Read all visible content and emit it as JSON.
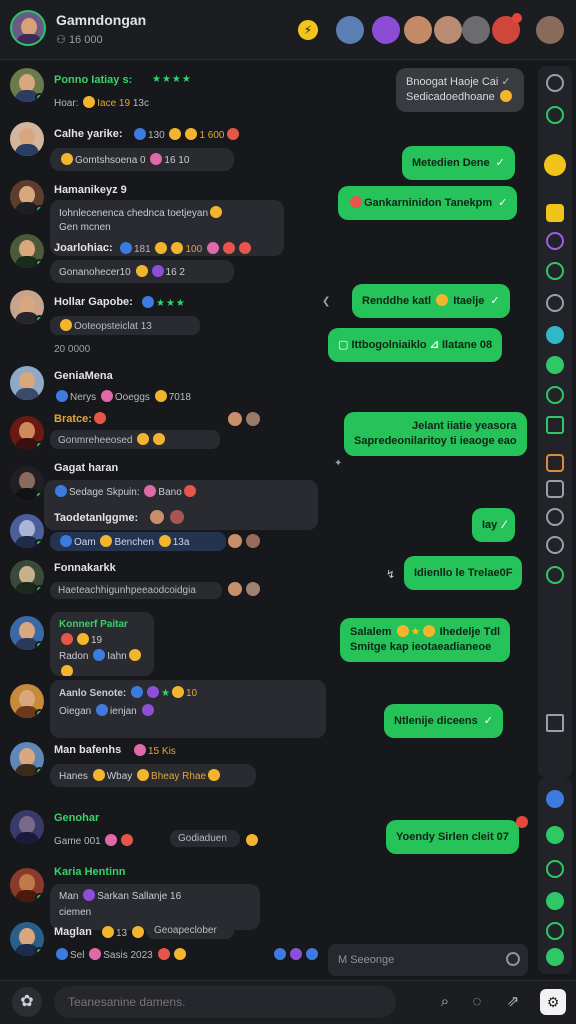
{
  "header": {
    "title": "Gamndongan",
    "subtitle": "16 000",
    "members_count_icon": "people-icon",
    "bolt_icon": "lightning-icon",
    "member_colors": [
      "#5b7fb5",
      "#8b4dd6",
      "#c28a66",
      "#b98b72",
      "#6b6b70",
      "#d1463a",
      "#8a6a5a"
    ]
  },
  "incoming": [
    {
      "name": "Ponno Iatiay s:",
      "meta": "Hoar: ",
      "meta_gold": "Iace 19",
      "meta2": "13c",
      "stars": "★★★★",
      "color": "#6a7a4a"
    },
    {
      "name": "Calhe yarike:",
      "meta": "130",
      "meta_gold": "1 600",
      "bubble": "Gomtshsoena 0",
      "bubble_tail": "16 10",
      "color": "#d3b6a0"
    },
    {
      "name": "Hamanikeyz 9",
      "bubble": "Iohnlecenenca chednca toetjeyan",
      "bubble2": "Gen mcnen",
      "color": "#5e3d2d"
    },
    {
      "name": "Joarlohiac:",
      "meta": "181",
      "meta_gold": "100",
      "bubble": "Gonanohecer10",
      "bubble_tail": "16 2",
      "color": "#4a5a3a"
    },
    {
      "name": "Hollar Gapobe:",
      "stars": "★★★",
      "bubble": "Ooteopsteiclat 13",
      "dateline": "20 0000",
      "color": "#c7a48a"
    },
    {
      "name": "GeniaMena",
      "meta": "Nerys",
      "meta2": "Ooeggs",
      "meta3": "7018",
      "color": "#8fa9c7"
    },
    {
      "name": "Bratce:",
      "bubble": "Gonmreheeosed",
      "color": "#6a1a10"
    },
    {
      "name": "Gagat haran",
      "bubble": "Sedage Skpuin:",
      "bubble_tail": "Bano",
      "color": "#202024"
    },
    {
      "name": "Taodetanlggme:",
      "bubble": "Oam",
      "bubble_mid": "Benchen",
      "bubble_tail": "13a",
      "color": "#4d5f9a"
    },
    {
      "name": "Fonnakarkk",
      "bubble": "Haeteachhigunhpeeaodcoidgia",
      "color": "#3a4a3a"
    },
    {
      "name": "Konnerf Paitar",
      "meta": "19",
      "meta2": "Radon",
      "meta3": "Iahn",
      "color": "#3a6aa6"
    },
    {
      "name": "Aanlo Senote:",
      "meta": "10",
      "bubble_line2": "Oiegan",
      "bubble_line2b": "ienjan",
      "color": "#c78a3a"
    },
    {
      "name": "Man bafenhs",
      "meta": "15 Kis",
      "bubble": "Hanes",
      "bubble_mid": "Wbay",
      "bubble_tail": "Bheay Rhae",
      "color": "#5d88b8"
    },
    {
      "name": "Genohar",
      "meta": "Game 001",
      "bubble": "Godiaduen",
      "color": "#3a3a6a"
    },
    {
      "name": "Karia Hentinn",
      "meta": "Man",
      "meta2": "Sarkan Sallanje 16",
      "bubble2": "ciemen",
      "color": "#8a3a2a"
    },
    {
      "name": "Maglan",
      "meta": "13",
      "bubble": "Geoapeclober",
      "meta_line2": "Sel",
      "meta_line2b": "Sasis 2023",
      "color": "#2c5e8a"
    }
  ],
  "outgoing": [
    {
      "text": "Bnoogat Haoje Cai",
      "text2": "Sedicadoedhoane",
      "style": "gray"
    },
    {
      "text": "Metedien Dene",
      "style": "green"
    },
    {
      "text": "Gankarninidon Tanekpm",
      "style": "green"
    },
    {
      "text": "Renddhe katl",
      "text_tail": "Itaelje",
      "style": "green"
    },
    {
      "text": "Ittbogolniaiklo",
      "text_tail": "Ilatane 08",
      "style": "green"
    },
    {
      "text": "Jelant iiatie yeasora",
      "text2": "Sapredeonilaritoy ti ieaoge eao",
      "style": "green-tall"
    },
    {
      "text": "Iay",
      "style": "green"
    },
    {
      "text": "Idienllo le Trelae0F",
      "style": "green"
    },
    {
      "text": "Salalem",
      "text_tail": "Ihedelje Tdl",
      "text2": "Smitge kap ieotaeadianeoe",
      "style": "green-tall"
    },
    {
      "text": "Ntlenije",
      "text_tail": "diceens",
      "style": "green"
    },
    {
      "text": "Yoendy Sirlen cleit 07",
      "style": "green"
    }
  ],
  "search": {
    "placeholder": "M Seeonge"
  },
  "composer": {
    "placeholder": "Teanesanine damens."
  },
  "icons": [
    "flower-icon",
    "search-icon",
    "sticker-icon",
    "share-icon",
    "settings-icon"
  ]
}
